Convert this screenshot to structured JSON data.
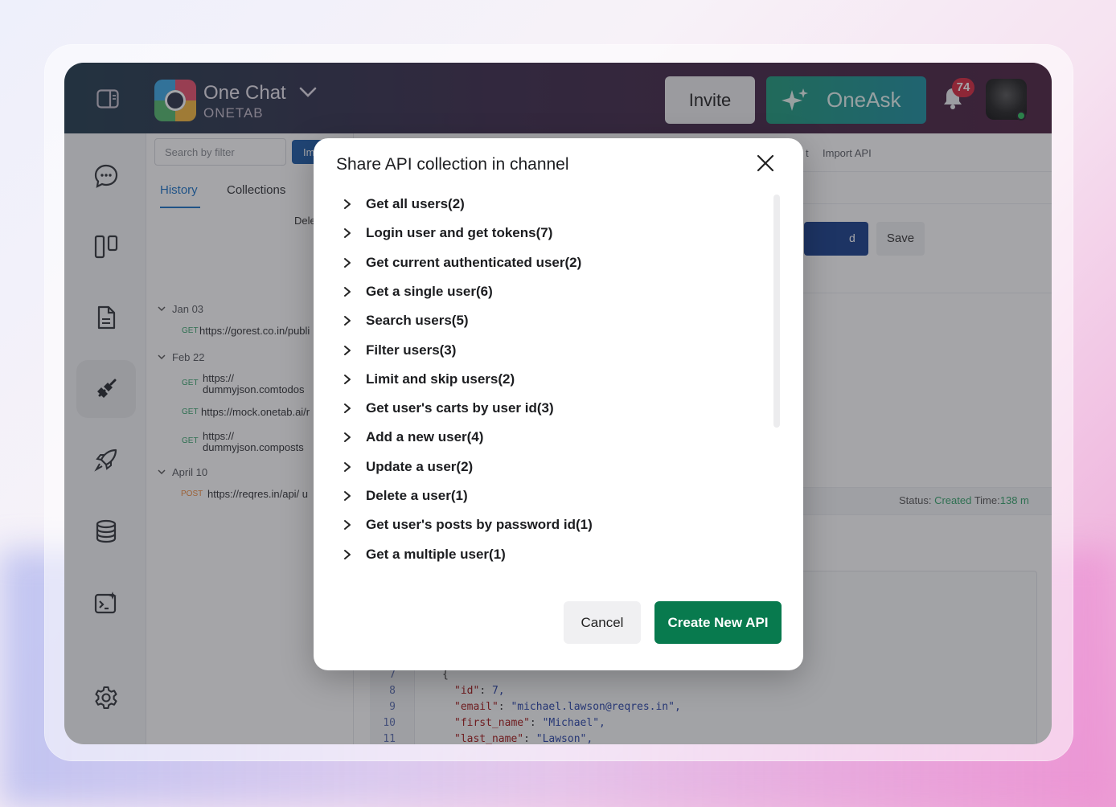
{
  "header": {
    "app_name": "One Chat",
    "app_sub": "ONETAB",
    "invite_label": "Invite",
    "oneask_label": "OneAsk",
    "notification_count": "74"
  },
  "history": {
    "search_placeholder": "Search by filter",
    "import_label": "Im",
    "tabs": [
      "History",
      "Collections"
    ],
    "delete_label": "Dele",
    "groups": [
      {
        "label": "Jan 03",
        "items": [
          {
            "method": "GET",
            "url": "https://gorest.co.in/publi"
          }
        ]
      },
      {
        "label": "Feb 22",
        "items": [
          {
            "method": "GET",
            "url_line1": "https://",
            "url_line2": "dummyjson.comtodos"
          },
          {
            "method": "GET",
            "url": "https://mock.onetab.ai/r"
          },
          {
            "method": "GET",
            "url_line1": "https://",
            "url_line2": "dummyjson.composts"
          }
        ]
      },
      {
        "label": "April 10",
        "items": [
          {
            "method": "POST",
            "url": "https://reqres.in/api/ u"
          }
        ]
      }
    ]
  },
  "request": {
    "tab_fragment": "t",
    "import_api_label": "Import API",
    "send_fragment": "d",
    "save_label": "Save",
    "status_label": "Status: ",
    "status_value": "Created",
    "time_label": " Time:",
    "time_value": "138 m"
  },
  "code": {
    "lines": [
      {
        "n": "7",
        "text": "{"
      },
      {
        "n": "8",
        "key": "\"id\"",
        "value": "7,"
      },
      {
        "n": "9",
        "key": "\"email\"",
        "value": "\"michael.lawson@reqres.in\","
      },
      {
        "n": "10",
        "key": "\"first_name\"",
        "value": "\"Michael\","
      },
      {
        "n": "11",
        "key": "\"last_name\"",
        "value": "\"Lawson\","
      }
    ]
  },
  "modal": {
    "title": "Share API collection in channel",
    "items": [
      "Get all users(2)",
      "Login user and get tokens(7)",
      "Get current authenticated user(2)",
      "Get a single user(6)",
      "Search users(5)",
      "Filter users(3)",
      "Limit and skip users(2)",
      "Get user's carts by user id(3)",
      "Add a new user(4)",
      "Update a user(2)",
      "Delete a user(1)",
      "Get user's posts by password id(1)",
      "Get a multiple user(1)"
    ],
    "cancel_label": "Cancel",
    "create_label": "Create New API"
  },
  "colors": {
    "accent_green": "#087a4e",
    "badge_red": "#d7263d",
    "link_blue": "#1a73c7"
  }
}
